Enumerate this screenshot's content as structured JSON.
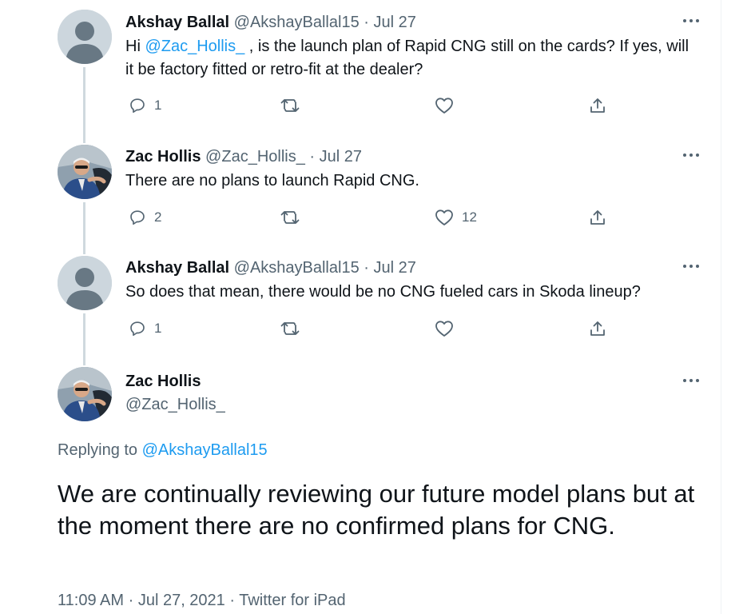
{
  "replies": [
    {
      "name": "Akshay Ballal",
      "handle": "@AkshayBallal15",
      "dot": "·",
      "date": "Jul 27",
      "text_before": "Hi ",
      "mention": "@Zac_Hollis_",
      "text_after": " , is the launch plan of Rapid CNG still on the cards? If yes, will it be factory fitted or retro-fit at the dealer?",
      "reply_count": "1",
      "retweet_count": "",
      "like_count": ""
    },
    {
      "name": "Zac Hollis",
      "handle": "@Zac_Hollis_",
      "dot": "·",
      "date": "Jul 27",
      "text": "There are no plans to launch Rapid CNG.",
      "reply_count": "2",
      "retweet_count": "",
      "like_count": "12"
    },
    {
      "name": "Akshay Ballal",
      "handle": "@AkshayBallal15",
      "dot": "·",
      "date": "Jul 27",
      "text": "So does that mean, there would be no CNG fueled cars in Skoda lineup?",
      "reply_count": "1",
      "retweet_count": "",
      "like_count": ""
    }
  ],
  "main_tweet": {
    "name": "Zac Hollis",
    "handle": "@Zac_Hollis_",
    "replying_prefix": "Replying to ",
    "replying_to": "@AkshayBallal15",
    "text": "We are continually reviewing our future model plans but at the moment there are no confirmed plans for CNG.",
    "time": "11:09 AM",
    "sep1": "·",
    "date": "Jul 27, 2021",
    "sep2": "·",
    "source": "Twitter for iPad"
  },
  "icons": {
    "more": "more-horizontal-icon",
    "reply": "reply-bubble-icon",
    "retweet": "retweet-icon",
    "like": "heart-icon",
    "share": "share-upload-icon",
    "default_avatar": "default-avatar-icon"
  },
  "colors": {
    "link": "#1d9bf0",
    "secondary_text": "#536471",
    "primary_text": "#0f1419",
    "thread_line": "#cfd9de"
  }
}
